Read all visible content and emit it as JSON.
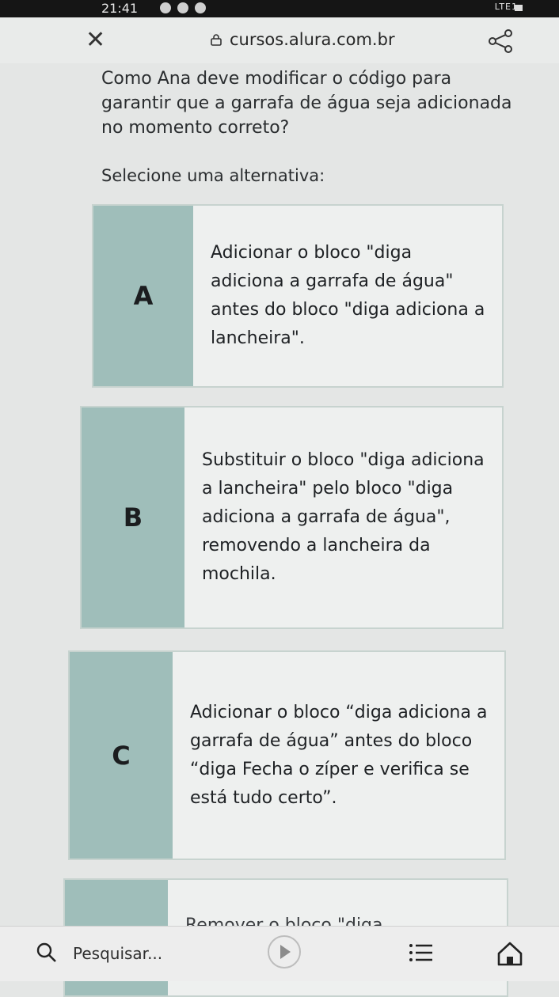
{
  "status_bar": {
    "time": "21:41",
    "network": "LTE1"
  },
  "browser": {
    "url": "cursos.alura.com.br"
  },
  "question": {
    "text": "Como Ana deve modificar o código para garantir que a garrafa de água seja adicionada no momento correto?",
    "prompt": "Selecione uma alternativa:"
  },
  "options": [
    {
      "letter": "A",
      "text": "Adicionar o bloco \"diga adiciona a garrafa de água\" antes do bloco \"diga adiciona a lancheira\"."
    },
    {
      "letter": "B",
      "text": "Substituir o bloco \"diga adiciona a lancheira\" pelo bloco \"diga adiciona a garrafa de água\", removendo a lancheira da mochila."
    },
    {
      "letter": "C",
      "text": "Adicionar o bloco “diga adiciona a garrafa de água” antes do bloco “diga Fecha o zíper e verifica se está tudo certo”."
    },
    {
      "letter": "",
      "text": "Remover o bloco \"diga"
    }
  ],
  "toolbar": {
    "search_placeholder": "Pesquisar..."
  },
  "colors": {
    "option_accent": "#9fbeba",
    "background": "#e4e6e5"
  }
}
